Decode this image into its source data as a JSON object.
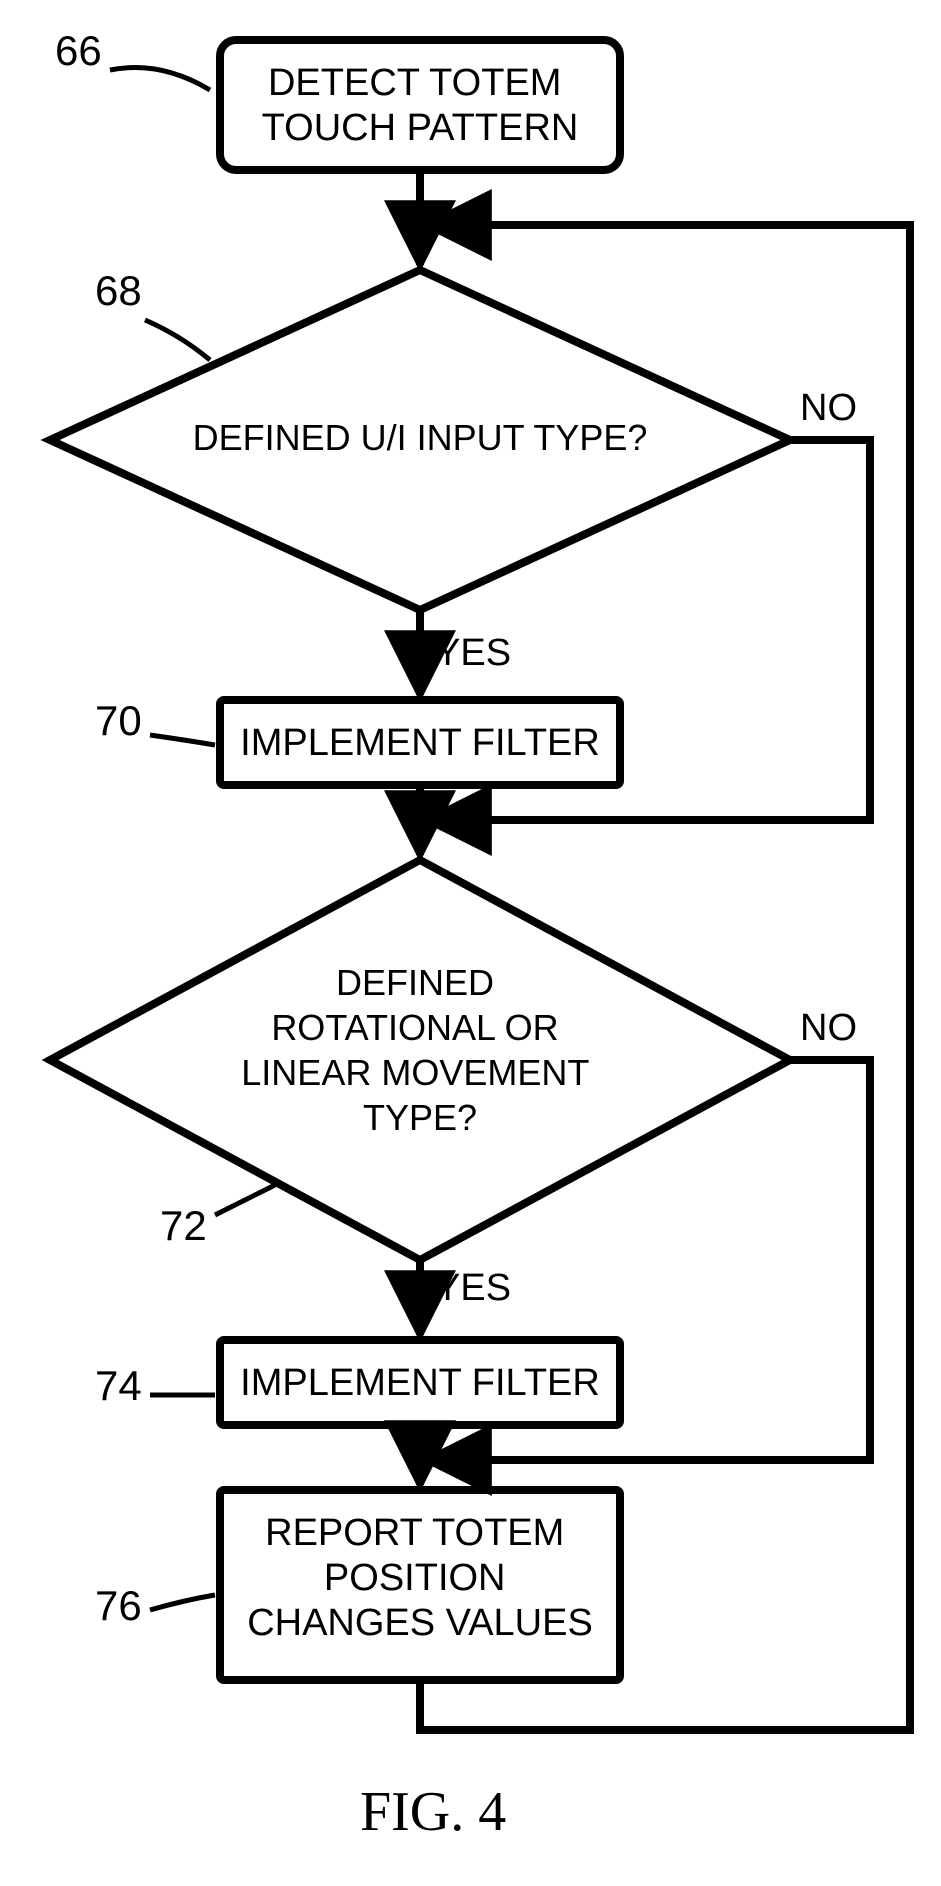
{
  "figure_label": "FIG. 4",
  "nodes": {
    "n66": {
      "ref": "66",
      "lines": [
        "DETECT TOTEM",
        "TOUCH PATTERN"
      ]
    },
    "n68": {
      "ref": "68",
      "lines": [
        "DEFINED U/I INPUT TYPE?"
      ]
    },
    "n70": {
      "ref": "70",
      "lines": [
        "IMPLEMENT FILTER"
      ]
    },
    "n72": {
      "ref": "72",
      "lines": [
        "DEFINED",
        "ROTATIONAL OR",
        "LINEAR MOVEMENT",
        "TYPE?"
      ]
    },
    "n74": {
      "ref": "74",
      "lines": [
        "IMPLEMENT FILTER"
      ]
    },
    "n76": {
      "ref": "76",
      "lines": [
        "REPORT TOTEM",
        "POSITION",
        "CHANGES VALUES"
      ]
    }
  },
  "edges": {
    "yes68": "YES",
    "no68": "NO",
    "yes72": "YES",
    "no72": "NO"
  }
}
